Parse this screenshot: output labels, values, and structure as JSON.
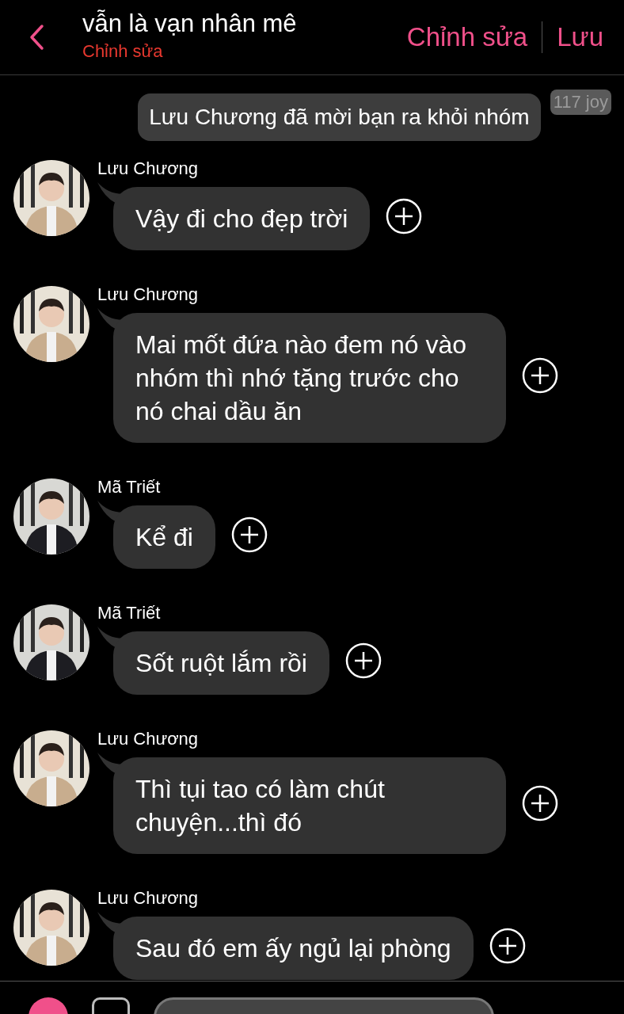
{
  "header": {
    "title": "vẫn là vạn nhân mê",
    "subtitle": "Chỉnh sửa",
    "actions": [
      "Chỉnh sửa",
      "Lưu"
    ]
  },
  "system_message": {
    "text": "Lưu Chương đã mời bạn ra khỏi nhóm",
    "badge": "117 joy"
  },
  "messages": [
    {
      "sender": "Lưu Chương",
      "text": "Vậy đi cho đẹp trời"
    },
    {
      "sender": "Lưu Chương",
      "text": "Mai mốt đứa nào đem nó vào nhóm thì nhớ tặng trước cho nó chai dầu ăn"
    },
    {
      "sender": "Mã Triết",
      "text": "Kể đi"
    },
    {
      "sender": "Mã Triết",
      "text": "Sốt ruột lắm rồi"
    },
    {
      "sender": "Lưu Chương",
      "text": "Thì tụi tao có làm chút chuyện...thì đó"
    },
    {
      "sender": "Lưu Chương",
      "text": "Sau đó em ấy ngủ lại phòng"
    }
  ]
}
